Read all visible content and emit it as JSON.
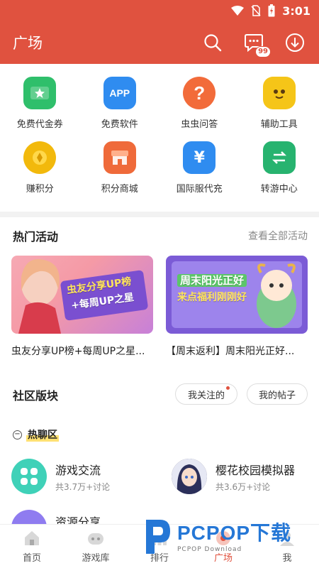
{
  "status_bar": {
    "time": "3:01",
    "icons": [
      "wifi-icon",
      "no-sim-icon",
      "battery-charging-icon"
    ]
  },
  "header": {
    "title": "广场",
    "message_badge": "99",
    "icons": [
      "search-icon",
      "message-icon",
      "download-icon"
    ]
  },
  "quick_menu": [
    {
      "label": "免费代金券",
      "icon": "coupon-icon",
      "color": "#2fbf6b"
    },
    {
      "label": "免费软件",
      "icon": "app-icon",
      "color": "#2f8cf0",
      "icon_text": "APP"
    },
    {
      "label": "虫虫问答",
      "icon": "question-icon",
      "color": "#f26b3a",
      "icon_text": "?"
    },
    {
      "label": "辅助工具",
      "icon": "robot-icon",
      "color": "#f5c518"
    },
    {
      "label": "赚积分",
      "icon": "gold-coin-icon",
      "color": "#f2b90c"
    },
    {
      "label": "积分商城",
      "icon": "shop-icon",
      "color": "#ef6a3a"
    },
    {
      "label": "国际服代充",
      "icon": "yen-card-icon",
      "color": "#2f8cf0",
      "icon_text": "¥"
    },
    {
      "label": "转游中心",
      "icon": "transfer-icon",
      "color": "#27b36f"
    }
  ],
  "hot_events": {
    "title": "热门活动",
    "more": "查看全部活动",
    "items": [
      {
        "banner_line1": "虫友分享UP榜",
        "banner_line2": "+每周UP之星",
        "caption": "虫友分享UP榜+每周UP之星..."
      },
      {
        "banner_line1": "周末阳光正好",
        "banner_line2": "来点福利刚刚好",
        "caption": "【周末返利】周末阳光正好..."
      }
    ]
  },
  "community": {
    "title": "社区版块",
    "pills": [
      "我关注的",
      "我的帖子"
    ],
    "hot_label": "热聊区",
    "forums": [
      {
        "name": "游戏交流",
        "meta": "共3.7万+讨论"
      },
      {
        "name": "樱花校园模拟器",
        "meta": "共3.6万+讨论"
      },
      {
        "name": "资源分享",
        "meta": ""
      }
    ]
  },
  "bottom_nav": [
    {
      "label": "首页",
      "active": false
    },
    {
      "label": "游戏库",
      "active": false
    },
    {
      "label": "排行",
      "active": false
    },
    {
      "label": "广场",
      "active": true
    },
    {
      "label": "我",
      "active": false
    }
  ],
  "watermark": {
    "brand": "PCPOP下载",
    "sub": "PCPOP Download"
  }
}
